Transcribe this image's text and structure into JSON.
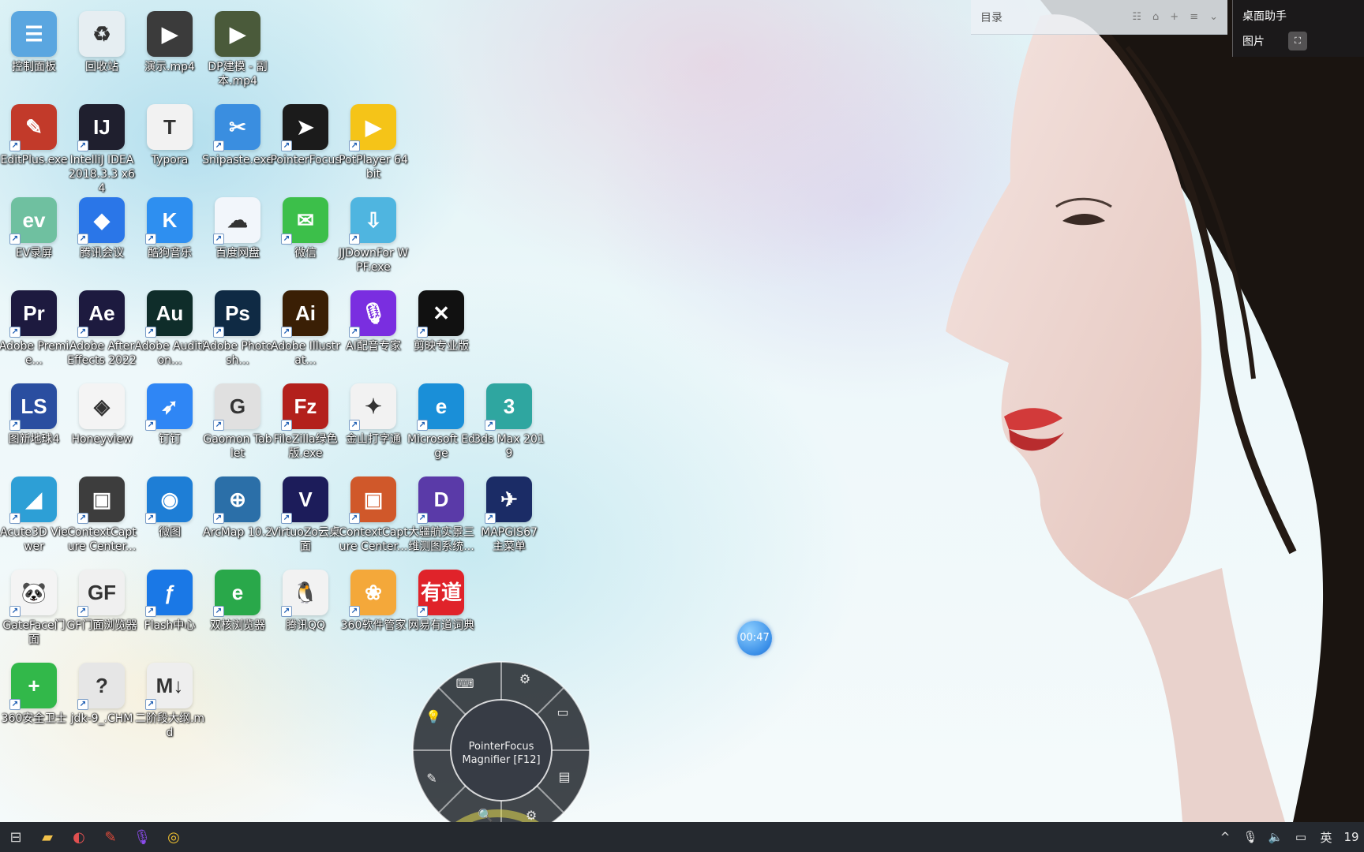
{
  "desktop": {
    "icons": [
      {
        "label": "控制面板",
        "glyph": "☰",
        "bg": "#5aa6e0",
        "col": 0,
        "row": 0,
        "shortcut": false
      },
      {
        "label": "回收站",
        "glyph": "♻",
        "bg": "#e6eef2",
        "col": 1,
        "row": 0,
        "shortcut": false
      },
      {
        "label": "演示.mp4",
        "glyph": "▶",
        "bg": "#3b3b3b",
        "col": 2,
        "row": 0,
        "shortcut": false
      },
      {
        "label": "DP建模 - 副本.mp4",
        "glyph": "▶",
        "bg": "#4a5a3a",
        "col": 3,
        "row": 0,
        "shortcut": false
      },
      {
        "label": "EditPlus.exe",
        "glyph": "✎",
        "bg": "#c23a2a",
        "col": 0,
        "row": 1,
        "shortcut": true
      },
      {
        "label": "IntelliJ IDEA 2018.3.3 x64",
        "glyph": "IJ",
        "bg": "#1f1f2e",
        "col": 1,
        "row": 1,
        "shortcut": true
      },
      {
        "label": "Typora",
        "glyph": "T",
        "bg": "#f2f2f2",
        "col": 2,
        "row": 1,
        "shortcut": false
      },
      {
        "label": "Snipaste.exe",
        "glyph": "✂",
        "bg": "#3a8ee0",
        "col": 3,
        "row": 1,
        "shortcut": true
      },
      {
        "label": "PointerFocus",
        "glyph": "➤",
        "bg": "#1b1b1b",
        "col": 4,
        "row": 1,
        "shortcut": true
      },
      {
        "label": "PotPlayer 64 bit",
        "glyph": "▶",
        "bg": "#f5c418",
        "col": 5,
        "row": 1,
        "shortcut": true
      },
      {
        "label": "EV录屏",
        "glyph": "ev",
        "bg": "#6fc0a0",
        "col": 0,
        "row": 2,
        "shortcut": true
      },
      {
        "label": "腾讯会议",
        "glyph": "◆",
        "bg": "#2a76e8",
        "col": 1,
        "row": 2,
        "shortcut": true
      },
      {
        "label": "酷狗音乐",
        "glyph": "K",
        "bg": "#2e8ff0",
        "col": 2,
        "row": 2,
        "shortcut": true
      },
      {
        "label": "百度网盘",
        "glyph": "☁",
        "bg": "#f2f6fb",
        "col": 3,
        "row": 2,
        "shortcut": true
      },
      {
        "label": "微信",
        "glyph": "✉",
        "bg": "#3cbf4a",
        "col": 4,
        "row": 2,
        "shortcut": true
      },
      {
        "label": "JJDownFor WPF.exe",
        "glyph": "⇩",
        "bg": "#4fb5e0",
        "col": 5,
        "row": 2,
        "shortcut": true
      },
      {
        "label": "Adobe Premie...",
        "glyph": "Pr",
        "bg": "#1d1a3f",
        "col": 0,
        "row": 3,
        "shortcut": true
      },
      {
        "label": "Adobe After Effects 2022",
        "glyph": "Ae",
        "bg": "#1d1a3f",
        "col": 1,
        "row": 3,
        "shortcut": true
      },
      {
        "label": "Adobe Audition...",
        "glyph": "Au",
        "bg": "#0f2d2a",
        "col": 2,
        "row": 3,
        "shortcut": true
      },
      {
        "label": "Adobe Photosh...",
        "glyph": "Ps",
        "bg": "#0f2a44",
        "col": 3,
        "row": 3,
        "shortcut": true
      },
      {
        "label": "Adobe Illustrat...",
        "glyph": "Ai",
        "bg": "#3a1f05",
        "col": 4,
        "row": 3,
        "shortcut": true
      },
      {
        "label": "AI配音专家",
        "glyph": "🎙",
        "bg": "#7a2ee0",
        "col": 5,
        "row": 3,
        "shortcut": true
      },
      {
        "label": "剪映专业版",
        "glyph": "✕",
        "bg": "#111111",
        "col": 6,
        "row": 3,
        "shortcut": true
      },
      {
        "label": "图新地球4",
        "glyph": "LS",
        "bg": "#2a4ea0",
        "col": 0,
        "row": 4,
        "shortcut": true
      },
      {
        "label": "Honeyview",
        "glyph": "◈",
        "bg": "#f4f4f4",
        "col": 1,
        "row": 4,
        "shortcut": false
      },
      {
        "label": "钉钉",
        "glyph": "➶",
        "bg": "#2f86f5",
        "col": 2,
        "row": 4,
        "shortcut": true
      },
      {
        "label": "Gaomon Tablet",
        "glyph": "G",
        "bg": "#e0e0e0",
        "col": 3,
        "row": 4,
        "shortcut": true
      },
      {
        "label": "FileZilla绿色版.exe",
        "glyph": "Fz",
        "bg": "#b3201c",
        "col": 4,
        "row": 4,
        "shortcut": true
      },
      {
        "label": "金山打字通",
        "glyph": "✦",
        "bg": "#f2f2f2",
        "col": 5,
        "row": 4,
        "shortcut": true
      },
      {
        "label": "Microsoft Edge",
        "glyph": "e",
        "bg": "#1a8fd8",
        "col": 6,
        "row": 4,
        "shortcut": true
      },
      {
        "label": "3ds Max 2019",
        "glyph": "3",
        "bg": "#2fa6a0",
        "col": 7,
        "row": 4,
        "shortcut": true
      },
      {
        "label": "Acute3D Viewer",
        "glyph": "◢",
        "bg": "#2d9fd6",
        "col": 0,
        "row": 5,
        "shortcut": true
      },
      {
        "label": "ContextCapture Center...",
        "glyph": "▣",
        "bg": "#3d3d3d",
        "col": 1,
        "row": 5,
        "shortcut": true
      },
      {
        "label": "微图",
        "glyph": "◉",
        "bg": "#1e7ed6",
        "col": 2,
        "row": 5,
        "shortcut": true
      },
      {
        "label": "ArcMap 10.2",
        "glyph": "⊕",
        "bg": "#2b6fa8",
        "col": 3,
        "row": 5,
        "shortcut": true
      },
      {
        "label": "VirtuoZo云桌面",
        "glyph": "V",
        "bg": "#1c1c5a",
        "col": 4,
        "row": 5,
        "shortcut": true
      },
      {
        "label": "ContextCapture Center...",
        "glyph": "▣",
        "bg": "#d0582a",
        "col": 5,
        "row": 5,
        "shortcut": true
      },
      {
        "label": "大疆航实景三维测图系统...",
        "glyph": "D",
        "bg": "#5a3aa8",
        "col": 6,
        "row": 5,
        "shortcut": true
      },
      {
        "label": "MAPGIS67 主菜单",
        "glyph": "✈",
        "bg": "#1b2c66",
        "col": 7,
        "row": 5,
        "shortcut": true
      },
      {
        "label": "GateFace门面",
        "glyph": "🐼",
        "bg": "#f4f4f4",
        "col": 0,
        "row": 6,
        "shortcut": true
      },
      {
        "label": "GF门面浏览器",
        "glyph": "GF",
        "bg": "#f0f0f0",
        "col": 1,
        "row": 6,
        "shortcut": true
      },
      {
        "label": "Flash中心",
        "glyph": "ƒ",
        "bg": "#1a78e6",
        "col": 2,
        "row": 6,
        "shortcut": true
      },
      {
        "label": "双核浏览器",
        "glyph": "e",
        "bg": "#29a84a",
        "col": 3,
        "row": 6,
        "shortcut": true
      },
      {
        "label": "腾讯QQ",
        "glyph": "🐧",
        "bg": "#f2f2f2",
        "col": 4,
        "row": 6,
        "shortcut": true
      },
      {
        "label": "360软件管家",
        "glyph": "❀",
        "bg": "#f4a83a",
        "col": 5,
        "row": 6,
        "shortcut": true
      },
      {
        "label": "网易有道词典",
        "glyph": "有道",
        "bg": "#e0232a",
        "col": 6,
        "row": 6,
        "shortcut": true
      },
      {
        "label": "360安全卫士",
        "glyph": "+",
        "bg": "#32b84a",
        "col": 0,
        "row": 7,
        "shortcut": true
      },
      {
        "label": "jdk-9_.CHM",
        "glyph": "?",
        "bg": "#e6e6e6",
        "col": 1,
        "row": 7,
        "shortcut": true
      },
      {
        "label": "二阶段大纲.md",
        "glyph": "M↓",
        "bg": "#eeeeee",
        "col": 2,
        "row": 7,
        "shortcut": true
      }
    ]
  },
  "topbar": {
    "title": "目录",
    "tools": [
      "☷",
      "⌂",
      "+",
      "≡",
      "⌄"
    ]
  },
  "assistant": {
    "title": "桌面助手",
    "item": "图片",
    "chip": "⛶"
  },
  "timer": {
    "value": "00:47"
  },
  "radial_menu": {
    "center_line1": "PointerFocus",
    "center_line2": "Magnifier [F12]",
    "buttons": [
      "⌨",
      "⚙",
      "▭",
      "💡",
      "✎",
      "🔍",
      "⚙",
      "▤"
    ]
  },
  "taskbar": {
    "items": [
      {
        "name": "task-view",
        "glyph": "⊟",
        "color": "#d0d0d0"
      },
      {
        "name": "file-explorer",
        "glyph": "▰",
        "color": "#f2c14a"
      },
      {
        "name": "app-paint",
        "glyph": "◐",
        "color": "#e05050"
      },
      {
        "name": "app-pen",
        "glyph": "✎",
        "color": "#e04b3a"
      },
      {
        "name": "app-voice",
        "glyph": "🎙",
        "color": "#8a4bea"
      },
      {
        "name": "chrome",
        "glyph": "◎",
        "color": "#f2c230"
      }
    ],
    "tray": {
      "chevron": "^",
      "mic": "🎙",
      "volume": "🔈",
      "network": "▭",
      "ime": "英",
      "clock": "19"
    }
  }
}
